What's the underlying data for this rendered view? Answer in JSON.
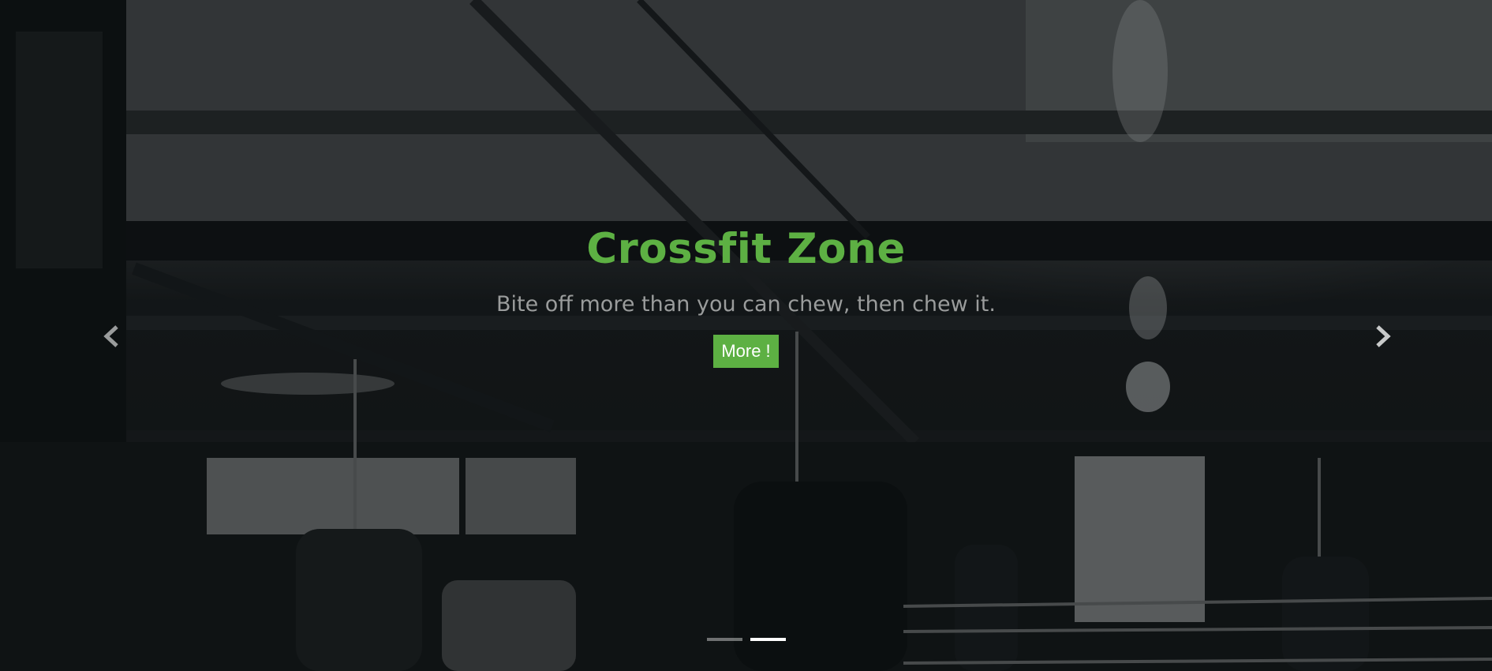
{
  "slide": {
    "title": "Crossfit Zone",
    "subtitle": "Bite off more than you can chew, then chew it.",
    "button_label": "More !"
  },
  "controls": {
    "prev_icon": "chevron-left-icon",
    "next_icon": "chevron-right-icon"
  },
  "indicators": {
    "count": 2,
    "active_index": 1
  },
  "colors": {
    "accent": "#5db043",
    "subtitle": "#9a9c9c"
  }
}
